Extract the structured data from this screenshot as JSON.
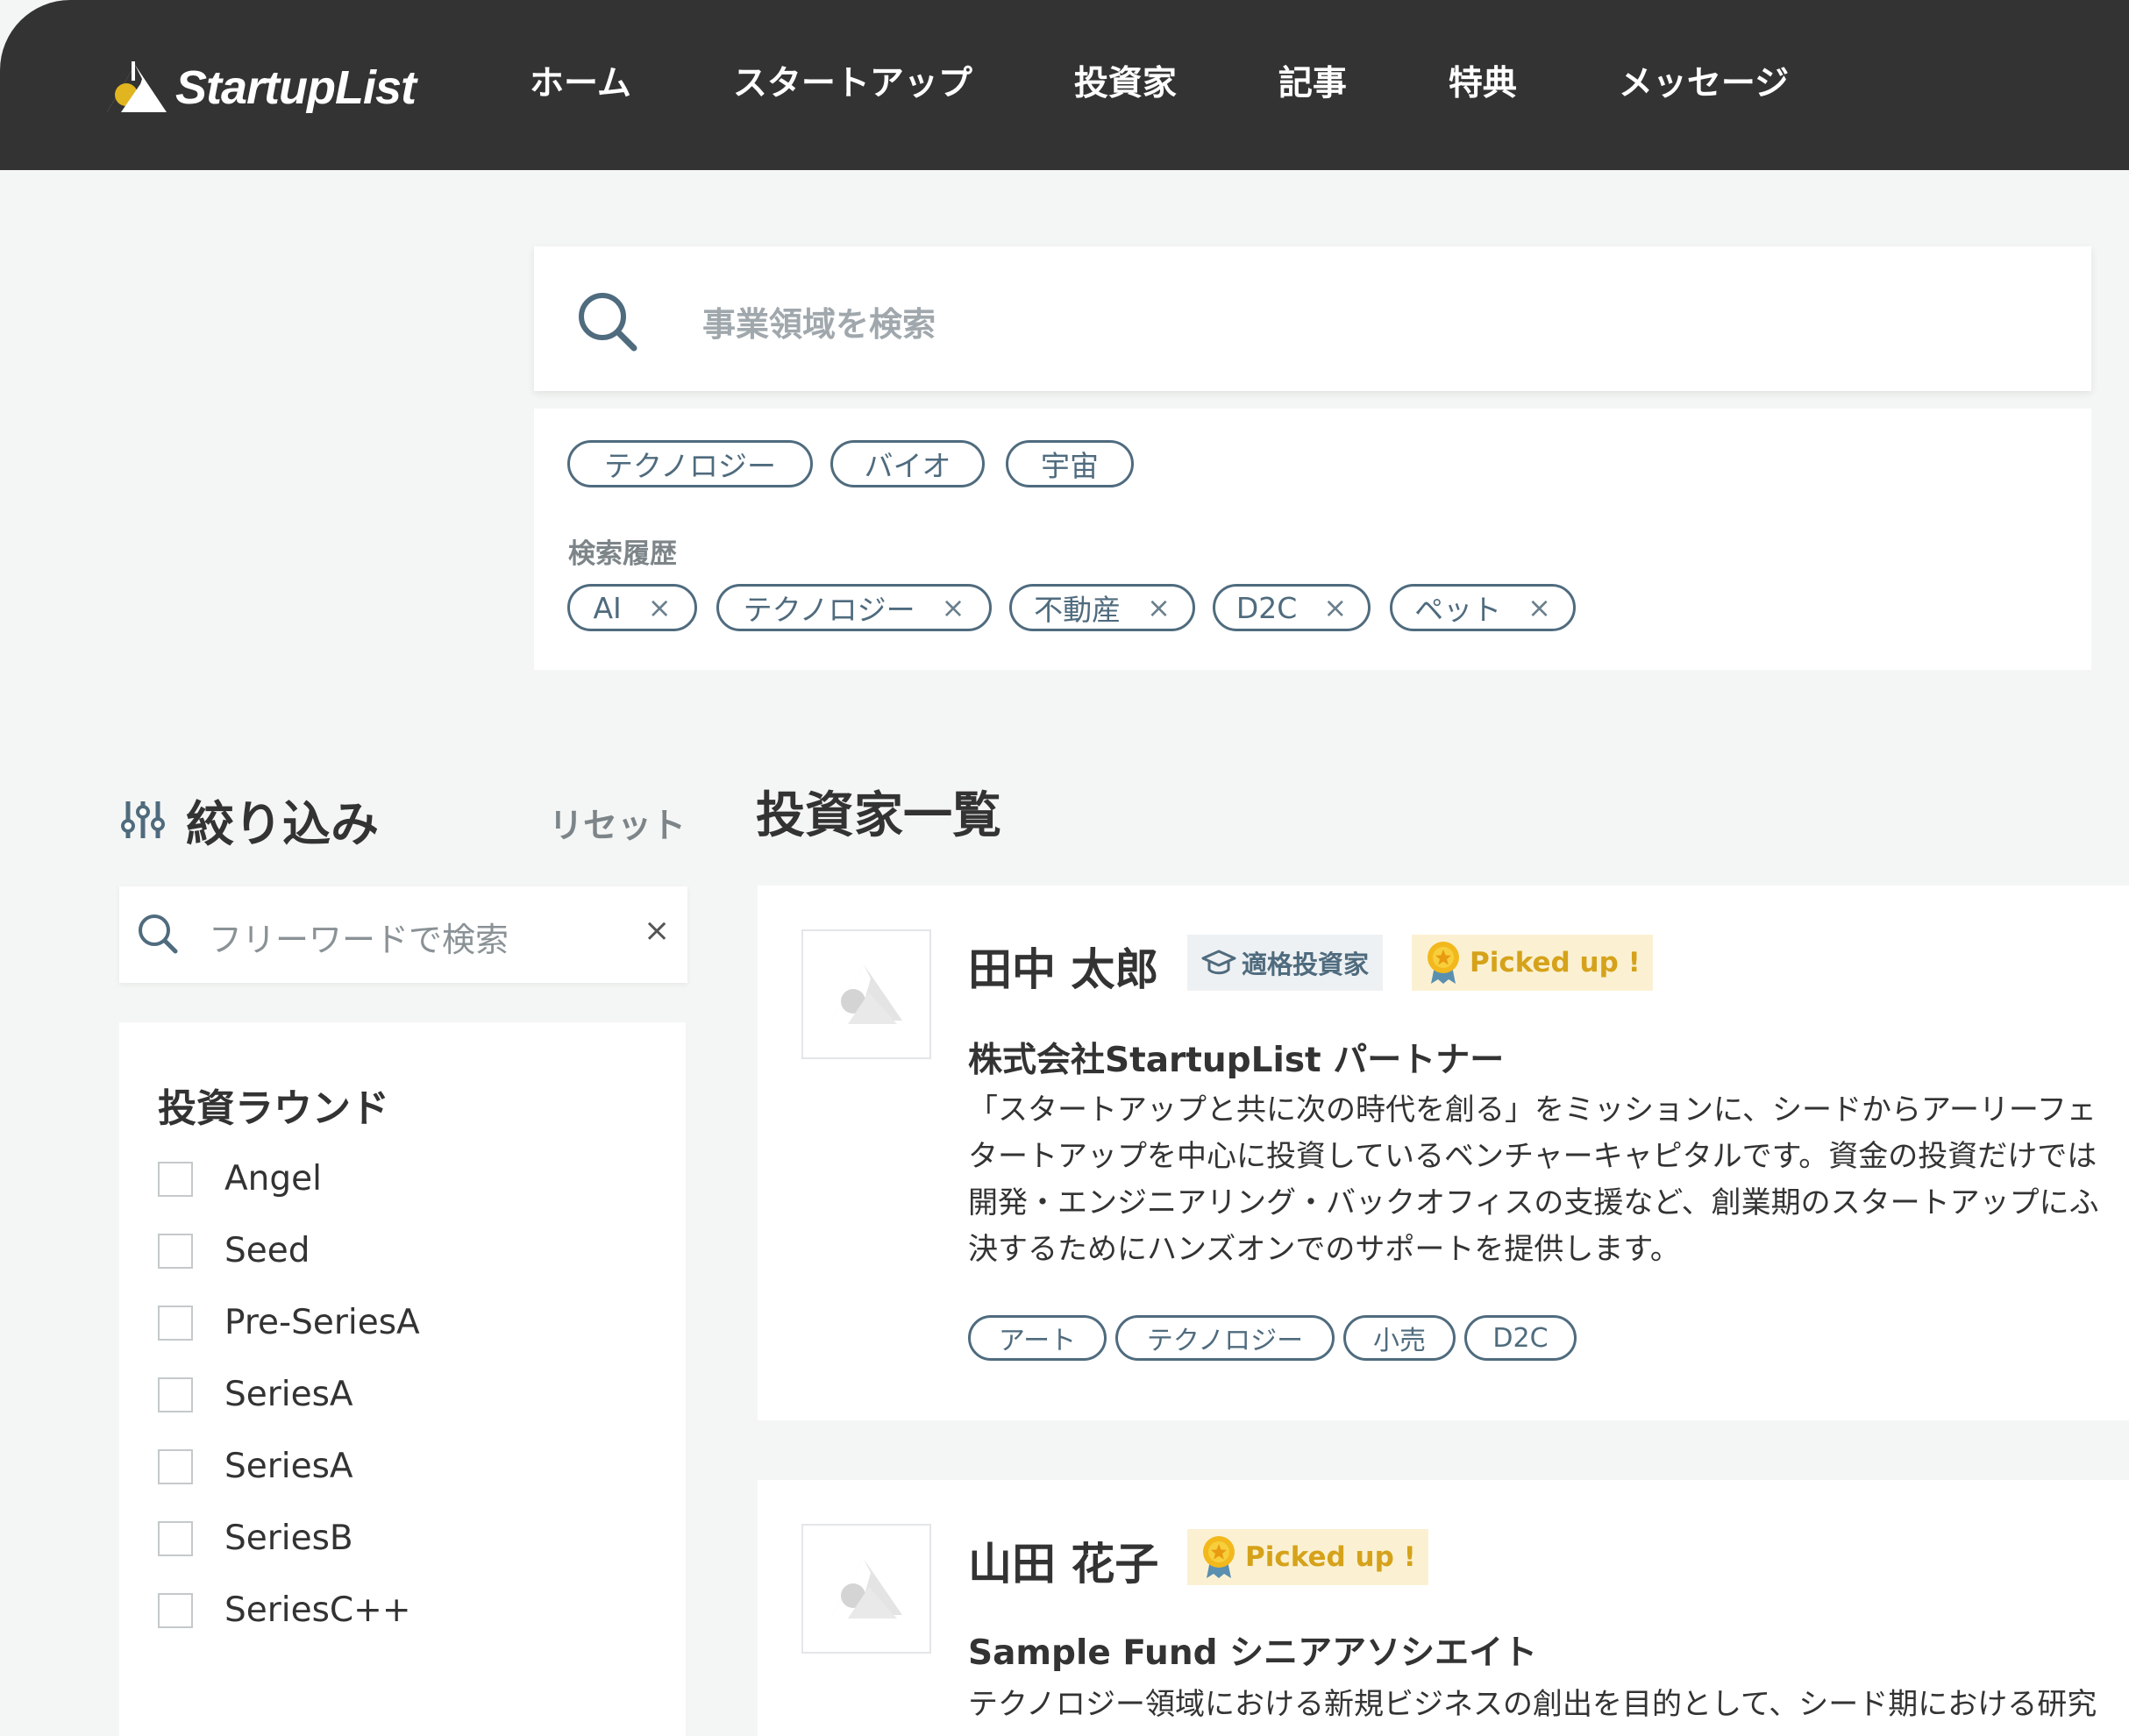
{
  "header": {
    "logo_text": "StartupList",
    "nav": [
      "ホーム",
      "スタートアップ",
      "投資家",
      "記事",
      "特典",
      "メッセージ"
    ]
  },
  "search": {
    "placeholder": "事業領域を検索",
    "suggested_tags": [
      "テクノロジー",
      "バイオ",
      "宇宙"
    ],
    "history_label": "検索履歴",
    "history": [
      "AI",
      "テクノロジー",
      "不動産",
      "D2C",
      "ペット"
    ]
  },
  "filter": {
    "title": "絞り込み",
    "reset": "リセット",
    "freeword_placeholder": "フリーワードで検索",
    "clear_symbol": "×",
    "round_title": "投資ラウンド",
    "rounds": [
      "Angel",
      "Seed",
      "Pre-SeriesA",
      "SeriesA",
      "SeriesA",
      "SeriesB",
      "SeriesC++"
    ]
  },
  "list": {
    "title": "投資家一覧",
    "investors": [
      {
        "name": "田中 太郎",
        "qualified_badge": "適格投資家",
        "picked_badge": "Picked up !",
        "org": "株式会社StartupList  パートナー",
        "desc_lines": [
          "「スタートアップと共に次の時代を創る」をミッションに、シードからアーリーフェ",
          "タートアップを中心に投資しているベンチャーキャピタルです。資金の投資だけでは",
          "開発・エンジニアリング・バックオフィスの支援など、創業期のスタートアップにふ",
          "決するためにハンズオンでのサポートを提供します。"
        ],
        "tags": [
          "アート",
          "テクノロジー",
          "小売",
          "D2C"
        ]
      },
      {
        "name": "山田 花子",
        "picked_badge": "Picked up !",
        "org": "Sample Fund  シニアアソシエイト",
        "desc_lines": [
          "テクノロジー領域における新規ビジネスの創出を目的として、シード期における研究"
        ]
      }
    ]
  },
  "colors": {
    "header_bg": "#333333",
    "accent": "#4f6b7e",
    "picked_bg": "#fbf1d2",
    "picked_text": "#d5a21a",
    "page_bg": "#f4f6f5"
  }
}
